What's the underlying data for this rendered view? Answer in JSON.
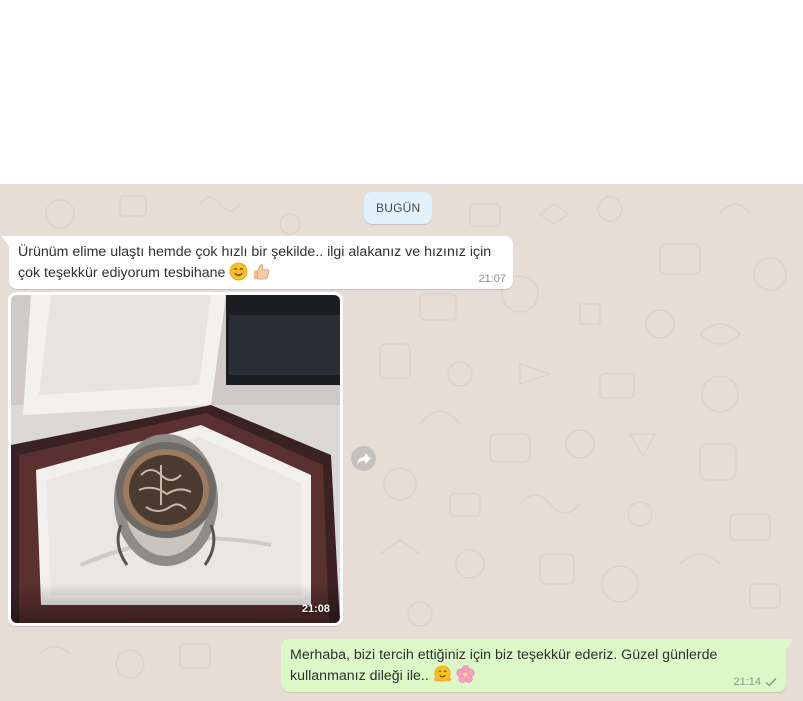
{
  "date_chip": {
    "label": "BUGÜN"
  },
  "messages": [
    {
      "direction": "incoming",
      "text_line1": "Ürünüm elime ulaştı hemde çok hızlı bir şekilde.. ilgi alakanız ve hızınız için",
      "text_line2": "çok teşekkür ediyorum tesbihane",
      "emojis": [
        "smiling-face-icon",
        "thumbs-up-icon"
      ],
      "time": "21:07"
    },
    {
      "direction": "incoming",
      "type": "image",
      "image_subject": "silver-ring-in-box",
      "time": "21:08"
    },
    {
      "direction": "outgoing",
      "text_line1": "Merhaba, bizi tercih ettiğiniz için biz teşekkür ederiz. Güzel günlerde",
      "text_line2": "kullanmanız dileği ile..",
      "emojis": [
        "hugging-face-icon",
        "cherry-blossom-icon"
      ],
      "time": "21:14",
      "status": "sent-single-check"
    }
  ],
  "colors": {
    "chat_background": "#e6ddd4",
    "incoming_bubble": "#ffffff",
    "outgoing_bubble": "#dcf8c6",
    "date_chip": "#e1f2fb"
  }
}
